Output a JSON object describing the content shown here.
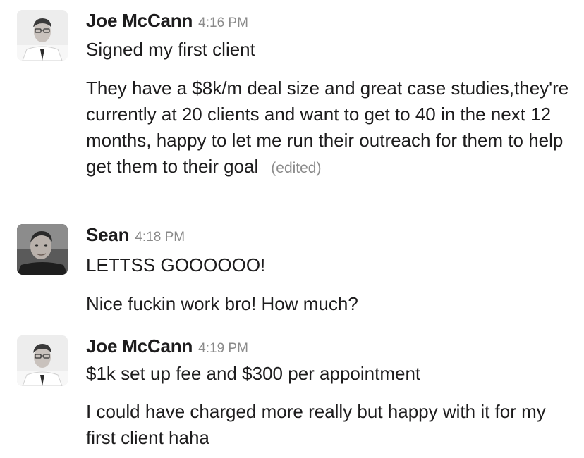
{
  "messages": [
    {
      "sender": "Joe McCann",
      "time": "4:16 PM",
      "lines": [
        "Signed my first client",
        "They have a $8k/m deal size and great case studies,they're currently at 20 clients and want to get to 40 in the next 12 months, happy to let me run their outreach for them to help get them to their goal"
      ],
      "edited_label": "(edited)"
    },
    {
      "sender": "Sean",
      "time": "4:18 PM",
      "lines": [
        "LETTSS GOOOOOO!",
        "Nice fuckin work bro! How much?"
      ]
    },
    {
      "sender": "Joe McCann",
      "time": "4:19 PM",
      "lines": [
        "$1k set up fee and $300 per appointment",
        "I could have charged more really but happy with it for my first client haha"
      ]
    }
  ]
}
